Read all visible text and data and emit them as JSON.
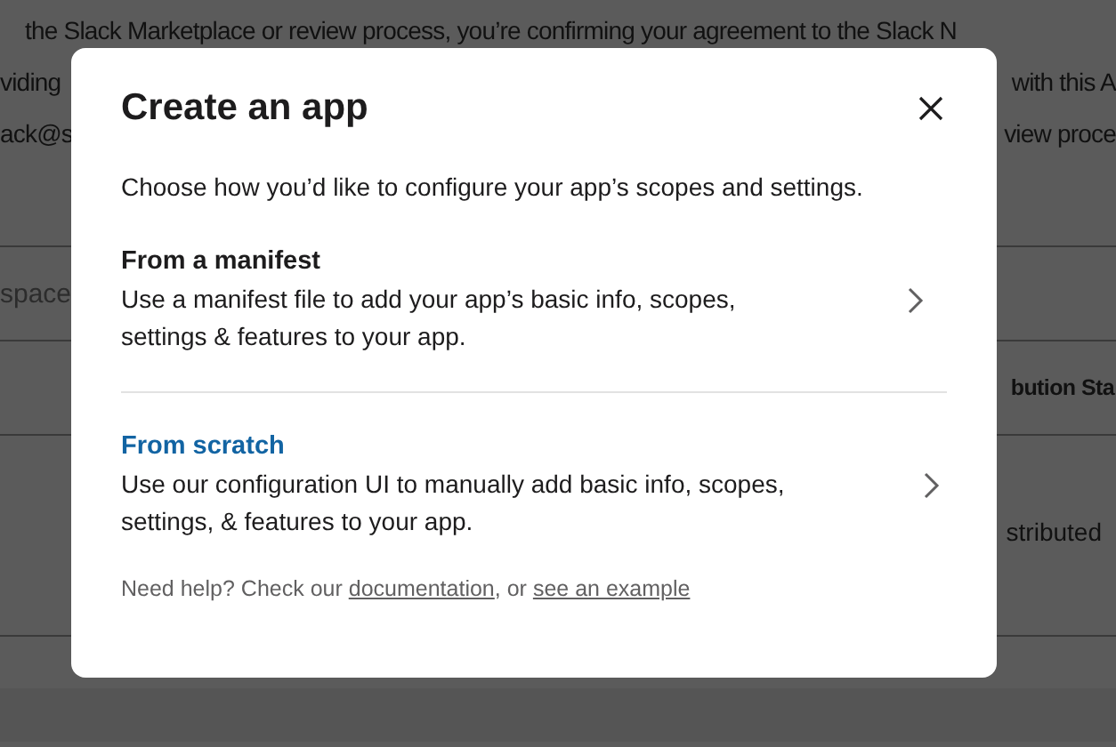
{
  "background": {
    "paragraph_lines": [
      {
        "left": "the Slack Marketplace or review process, you’re confirming your agreement to the Slack N"
      },
      {
        "left": "viding",
        "right": "with this A"
      },
      {
        "left": "ack@s",
        "right": "view proce"
      }
    ],
    "field_placeholder": "space",
    "table_header": "bution Sta",
    "table_cell": "stributed"
  },
  "dialog": {
    "title": "Create an app",
    "subtitle": "Choose how you’d like to configure your app’s scopes and settings.",
    "options": [
      {
        "title": "From a manifest",
        "description": "Use a manifest file to add your app’s basic info, scopes, settings & features to your app.",
        "highlighted": false
      },
      {
        "title": "From scratch",
        "description": "Use our configuration UI to manually add basic info, scopes, settings, & features to your app.",
        "highlighted": true
      }
    ],
    "help": {
      "text": "Need help? Check our",
      "link_1": "documentation",
      "separator": ", or",
      "link_2": "see an example"
    }
  }
}
